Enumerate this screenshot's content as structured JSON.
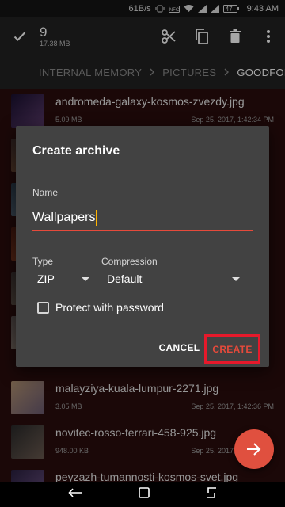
{
  "status_bar": {
    "net_speed": "61B/s",
    "battery": "47",
    "time": "9:43 AM"
  },
  "action_bar": {
    "selected_count": "9",
    "selected_size": "17.38 MB"
  },
  "breadcrumb": {
    "items": [
      "INTERNAL MEMORY",
      "PICTURES",
      "GOODFON"
    ]
  },
  "files": [
    {
      "name": "andromeda-galaxy-kosmos-zvezdy.jpg",
      "size": "5.09 MB",
      "date": "Sep 25, 2017, 1:42:34 PM",
      "thumb_color": "#3a2a4a"
    },
    {
      "name": "",
      "size": "",
      "date": "",
      "thumb_color": "#6b4a3a"
    },
    {
      "name": "",
      "size": "",
      "date": "",
      "thumb_color": "#5a6a7a"
    },
    {
      "name": "",
      "size": "",
      "date": "",
      "thumb_color": "#7a3a2a"
    },
    {
      "name": "",
      "size": "",
      "date": "",
      "thumb_color": "#6a5a4a"
    },
    {
      "name": "",
      "size": "",
      "date": "",
      "thumb_color": "#8a7a6a"
    },
    {
      "name": "malayziya-kuala-lumpur-2271.jpg",
      "size": "3.05 MB",
      "date": "Sep 25, 2017, 1:42:36 PM",
      "thumb_color": "#7a6a5a"
    },
    {
      "name": "novitec-rosso-ferrari-458-925.jpg",
      "size": "948.00 KB",
      "date": "Sep 25, 2017, 1:42:37 PM",
      "thumb_color": "#4a4040"
    },
    {
      "name": "peyzazh-tumannosti-kosmos-svet.jpg",
      "size": "",
      "date": "",
      "thumb_color": "#3a3050"
    }
  ],
  "dialog": {
    "title": "Create archive",
    "name_label": "Name",
    "name_value": "Wallpapers",
    "type_label": "Type",
    "type_value": "ZIP",
    "compression_label": "Compression",
    "compression_value": "Default",
    "protect_label": "Protect with password",
    "protect_checked": false,
    "cancel_label": "CANCEL",
    "create_label": "CREATE"
  },
  "colors": {
    "accent": "#e64a3b",
    "highlight_box": "#e6192b",
    "dialog_bg": "#424242",
    "list_bg": "#2a0d0d"
  }
}
